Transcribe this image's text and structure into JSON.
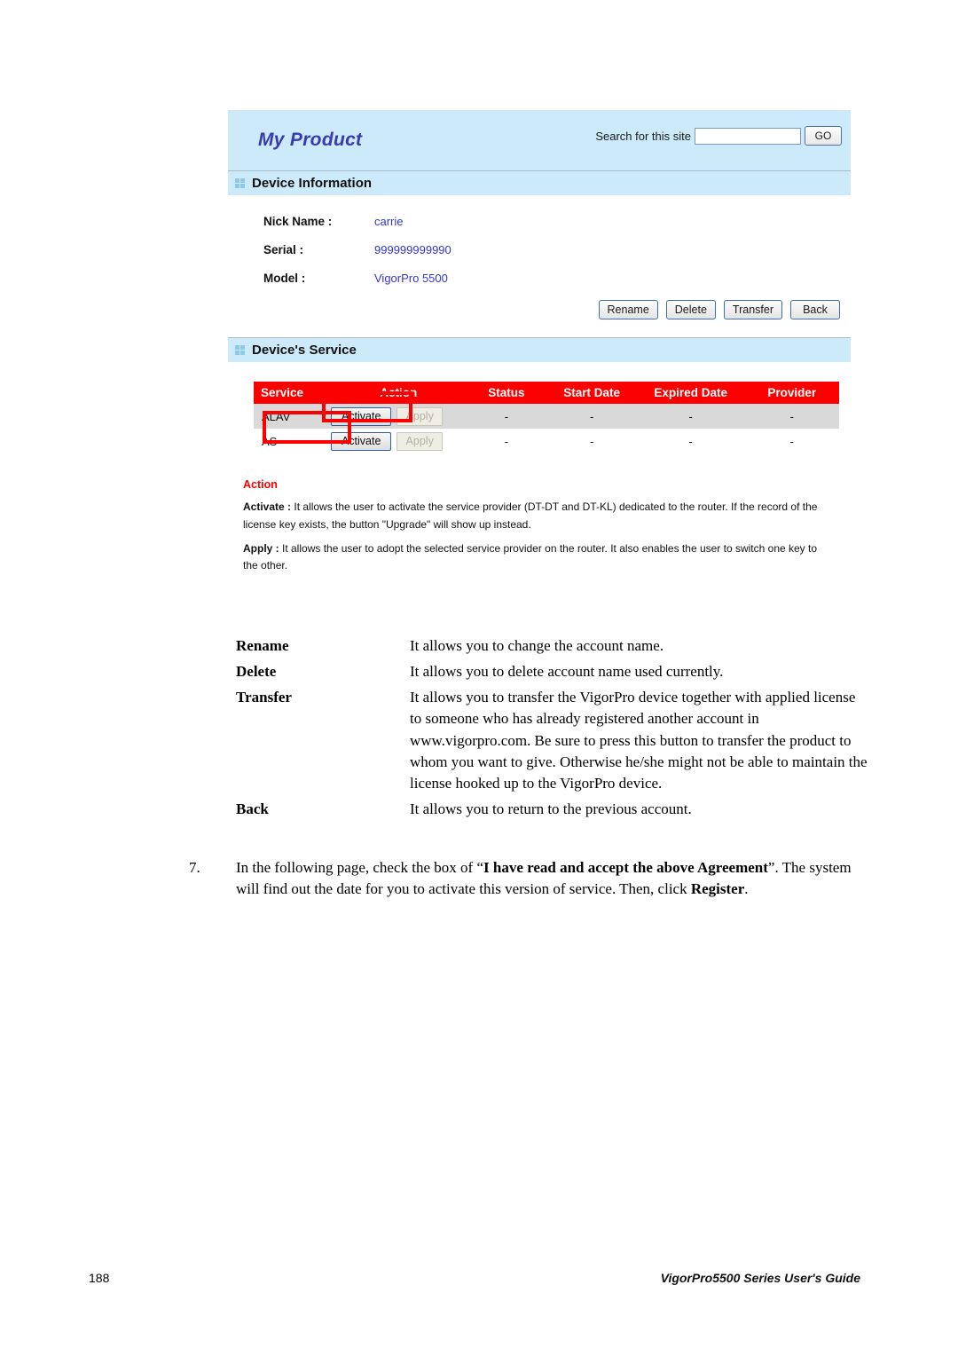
{
  "screenshot": {
    "banner": {
      "logo": "My Product",
      "search_label": "Search for this site",
      "search_value": "",
      "search_placeholder": "",
      "go_label": "GO"
    },
    "device_information": {
      "section_title": "Device Information",
      "rows": [
        {
          "label": "Nick Name :",
          "value": "carrie"
        },
        {
          "label": "Serial :",
          "value": "999999999990"
        },
        {
          "label": "Model :",
          "value": "VigorPro 5500"
        }
      ],
      "buttons": [
        {
          "label": "Rename"
        },
        {
          "label": "Delete"
        },
        {
          "label": "Transfer"
        },
        {
          "label": "Back"
        }
      ]
    },
    "devices_service": {
      "section_title": "Device's Service",
      "columns": [
        "Service",
        "Action",
        "Status",
        "Start Date",
        "Expired Date",
        "Provider"
      ],
      "rows": [
        {
          "service": "ALAV",
          "activate_label": "Activate",
          "apply_label": "Apply",
          "status": "-",
          "start_date": "-",
          "expired_date": "-",
          "provider": "-"
        },
        {
          "service": "AS",
          "activate_label": "Activate",
          "apply_label": "Apply",
          "status": "-",
          "start_date": "-",
          "expired_date": "-",
          "provider": "-"
        }
      ],
      "header_color": "#fb0000",
      "alt_row_color": "#d9d9d9",
      "annotation_color": "#fb0000"
    },
    "action_legend": {
      "title": "Action",
      "activate_term": "Activate :",
      "activate_desc": " It allows the user to activate the service provider (DT-DT and DT-KL) dedicated to the router. If the record of the license key exists, the button \"Upgrade\" will show up instead.",
      "apply_term": "Apply :",
      "apply_desc": " It allows the user to adopt the selected service provider on the router. It also enables the user to switch one key to the other."
    }
  },
  "document": {
    "definitions": [
      {
        "term": "Rename",
        "description": "It allows you to change the account name."
      },
      {
        "term": "Delete",
        "description": "It allows you to delete account name used currently."
      },
      {
        "term": "Transfer",
        "description": "It allows you to transfer the VigorPro device together with applied license to someone who has already registered another account in www.vigorpro.com. Be sure to press this button to transfer the product to whom you want to give. Otherwise he/she might not be able to maintain the license hooked up to the VigorPro device."
      },
      {
        "term": "Back",
        "description": "It allows you to return to the previous account."
      }
    ],
    "step": {
      "number": "7.",
      "part1": "In the following page, check the box of “",
      "bold1": "I have read and accept the above Agreement",
      "part2": "”. The system will find out the date for you to activate this version of service. Then, click ",
      "bold2": "Register",
      "part3": "."
    }
  },
  "footer": {
    "page_number": "188",
    "guide_title": "VigorPro5500 Series User's Guide"
  }
}
